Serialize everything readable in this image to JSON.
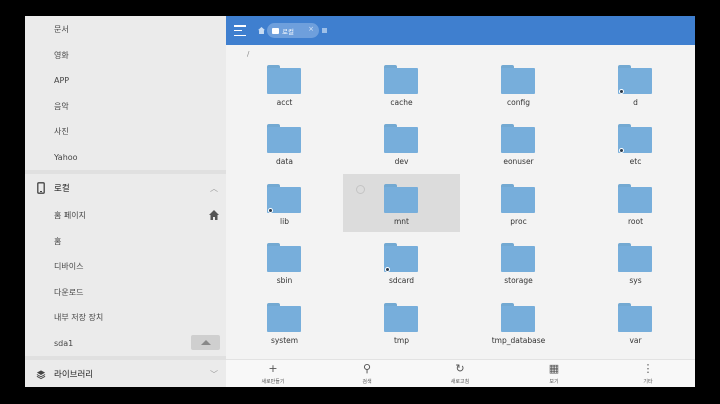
{
  "sidebar": {
    "top_items": [
      "문서",
      "영화",
      "APP",
      "음악",
      "사진",
      "Yahoo"
    ],
    "local_section": {
      "label": "로컬",
      "icon": "phone-icon"
    },
    "local_items": [
      {
        "label": "홈 페이지",
        "action": "home-icon"
      },
      {
        "label": "홈"
      },
      {
        "label": "디바이스"
      },
      {
        "label": "다운로드"
      },
      {
        "label": "내부 저장 장치"
      },
      {
        "label": "sda1",
        "action": "eject-icon"
      }
    ],
    "library_section": {
      "label": "라이브러리",
      "icon": "layers-icon"
    }
  },
  "topbar": {
    "menu_icon": "hamburger-menu-icon",
    "tab_label": "로컬",
    "tab_close": "×"
  },
  "path": "/",
  "folders": [
    {
      "name": "acct",
      "link": false
    },
    {
      "name": "cache",
      "link": false
    },
    {
      "name": "config",
      "link": false
    },
    {
      "name": "d",
      "link": true
    },
    {
      "name": "data",
      "link": false
    },
    {
      "name": "dev",
      "link": false
    },
    {
      "name": "eonuser",
      "link": false
    },
    {
      "name": "etc",
      "link": true
    },
    {
      "name": "lib",
      "link": true
    },
    {
      "name": "mnt",
      "link": false,
      "selected": true
    },
    {
      "name": "proc",
      "link": false
    },
    {
      "name": "root",
      "link": false
    },
    {
      "name": "sbin",
      "link": false
    },
    {
      "name": "sdcard",
      "link": true
    },
    {
      "name": "storage",
      "link": false
    },
    {
      "name": "sys",
      "link": false
    },
    {
      "name": "system",
      "link": false
    },
    {
      "name": "tmp",
      "link": false
    },
    {
      "name": "tmp_database",
      "link": false
    },
    {
      "name": "var",
      "link": false
    }
  ],
  "toolbar": [
    {
      "label": "새로만들기",
      "icon": "+",
      "name": "new-button",
      "icon_name": "plus-icon"
    },
    {
      "label": "검색",
      "icon": "⚲",
      "name": "search-button",
      "icon_name": "search-icon"
    },
    {
      "label": "새로고침",
      "icon": "↻",
      "name": "refresh-button",
      "icon_name": "refresh-icon"
    },
    {
      "label": "보기",
      "icon": "▦",
      "name": "view-button",
      "icon_name": "grid-view-icon"
    },
    {
      "label": "기타",
      "icon": "⋮",
      "name": "more-button",
      "icon_name": "more-vert-icon"
    }
  ],
  "colors": {
    "accent": "#3f7fcf",
    "folder": "#77aedb"
  }
}
